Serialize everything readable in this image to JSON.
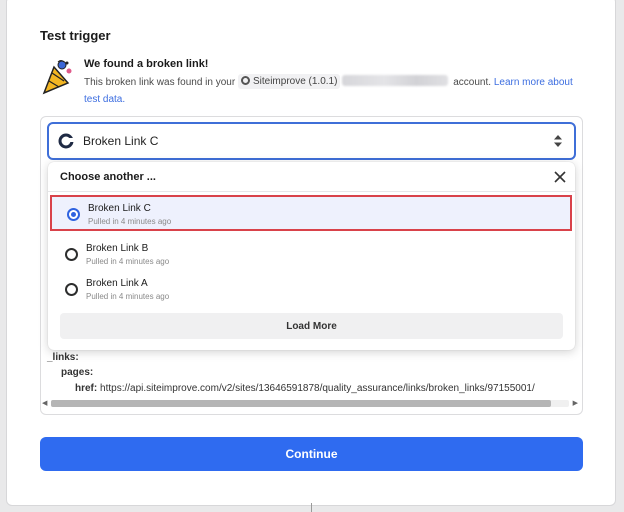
{
  "section_title": "Test trigger",
  "found": {
    "heading": "We found a broken link!",
    "text_before": "This broken link was found in your",
    "app_chip": "Siteimprove (1.0.1)",
    "text_after": "account.",
    "learn_more": "Learn more about test data."
  },
  "select": {
    "value": "Broken Link C"
  },
  "dropdown": {
    "heading": "Choose another ...",
    "options": [
      {
        "name": "Broken Link C",
        "sub": "Pulled in 4 minutes ago",
        "selected": true
      },
      {
        "name": "Broken Link B",
        "sub": "Pulled in 4 minutes ago",
        "selected": false
      },
      {
        "name": "Broken Link A",
        "sub": "Pulled in 4 minutes ago",
        "selected": false
      }
    ],
    "load_more": "Load More"
  },
  "data_preview": {
    "links_key": "_links:",
    "pages_key": "pages:",
    "href_key": "href:",
    "href_value": "https://api.siteimprove.com/v2/sites/13646591878/quality_assurance/links/broken_links/97155001/"
  },
  "continue_label": "Continue",
  "colors": {
    "accent": "#2f6bf0",
    "highlight_border": "#d9424a"
  }
}
